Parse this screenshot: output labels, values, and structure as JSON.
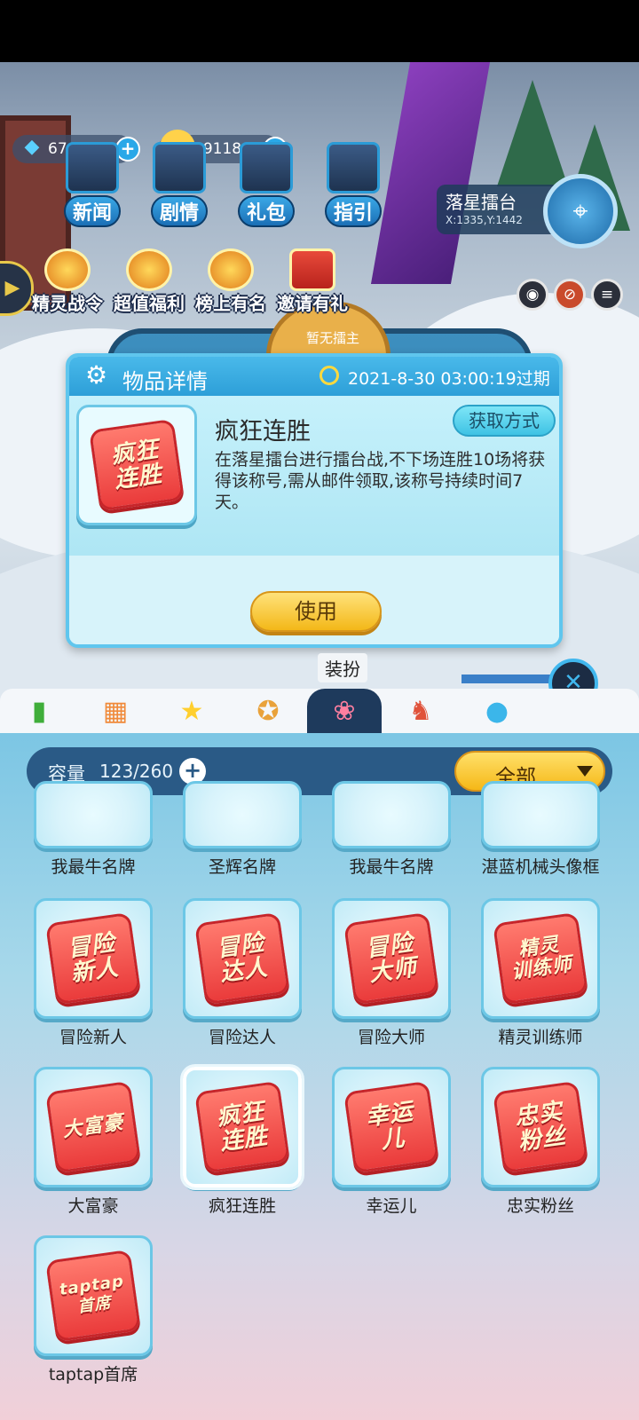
{
  "hud": {
    "gems": "67",
    "coins": "49118",
    "menu": [
      "新闻",
      "剧情",
      "礼包",
      "指引"
    ],
    "activities": [
      "精灵战令",
      "超值福利",
      "榜上有名",
      "邀请有礼"
    ],
    "location_name": "落星擂台",
    "location_coords": "X:1335,Y:1442",
    "arena_status": "暂无擂主"
  },
  "detail": {
    "title": "物品详情",
    "expire": "2021-8-30 03:00:19过期",
    "item_name": "疯狂连胜",
    "get_method": "获取方式",
    "description": "在落星擂台进行擂台战,不下场连胜10场将获得该称号,需从邮件领取,该称号持续时间7天。",
    "badge_text": "疯狂\n连胜",
    "use_label": "使用"
  },
  "tabs": {
    "tooltip": "装扮",
    "active_index": 4
  },
  "inventory": {
    "capacity_label": "容量",
    "capacity_value": "123/260",
    "filter_label": "全部",
    "partial_row": [
      "我最牛名牌",
      "圣辉名牌",
      "我最牛名牌",
      "湛蓝机械头像框"
    ],
    "items": [
      {
        "name": "冒险新人",
        "badge": "冒险\n新人"
      },
      {
        "name": "冒险达人",
        "badge": "冒险\n达人"
      },
      {
        "name": "冒险大师",
        "badge": "冒险\n大师"
      },
      {
        "name": "精灵训练师",
        "badge": "精灵\n训练师"
      },
      {
        "name": "大富豪",
        "badge": "大富豪"
      },
      {
        "name": "疯狂连胜",
        "badge": "疯狂\n连胜"
      },
      {
        "name": "幸运儿",
        "badge": "幸运\n儿"
      },
      {
        "name": "忠实粉丝",
        "badge": "忠实\n粉丝"
      },
      {
        "name": "taptap首席",
        "badge": "taptap\n首席"
      }
    ],
    "selected_index": 5
  }
}
